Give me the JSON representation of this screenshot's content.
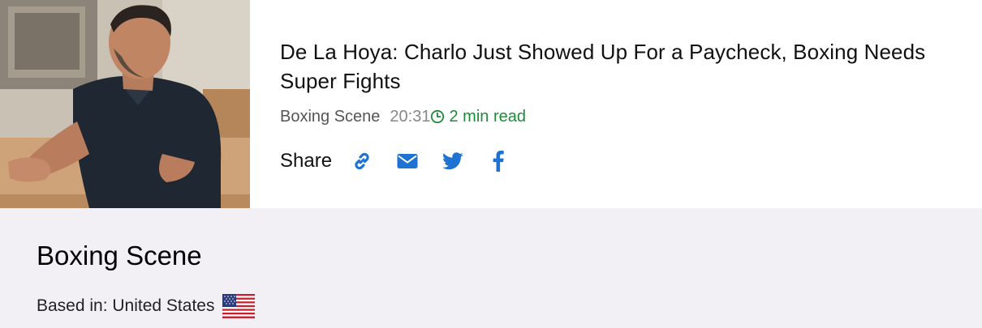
{
  "article": {
    "headline": "De La Hoya: Charlo Just Showed Up For a Paycheck, Boxing Needs Super Fights",
    "source": "Boxing Scene",
    "time": "20:31",
    "read_time": "2 min read",
    "image_icon": "article-photo"
  },
  "share": {
    "label": "Share",
    "buttons": [
      {
        "name": "copy-link",
        "icon": "link-icon"
      },
      {
        "name": "email",
        "icon": "envelope-icon"
      },
      {
        "name": "twitter",
        "icon": "twitter-icon"
      },
      {
        "name": "facebook",
        "icon": "facebook-icon"
      }
    ]
  },
  "source_info": {
    "name": "Boxing Scene",
    "based_in": "Based in: United States",
    "flag_icon": "us-flag-icon"
  },
  "colors": {
    "accent": "#1e73d2",
    "read_time": "#1e8a3a",
    "panel_bg": "#f2f0f5"
  }
}
